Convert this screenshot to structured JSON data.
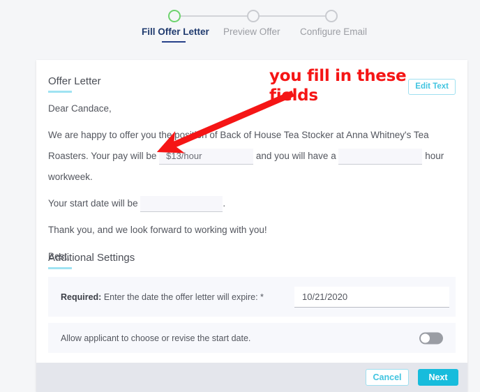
{
  "stepper": {
    "steps": [
      {
        "label": "Fill Offer Letter",
        "state": "active"
      },
      {
        "label": "Preview Offer",
        "state": "upcoming"
      },
      {
        "label": "Configure Email",
        "state": "upcoming"
      }
    ]
  },
  "card": {
    "offer_section": {
      "title": "Offer Letter",
      "edit_button": "Edit Text",
      "greeting": "Dear Candace,",
      "body_part_1": "We are happy to offer you the position of Back of House Tea Stocker at Anna Whitney's Tea Roasters. Your pay will be",
      "pay_value": "$13/hour",
      "body_part_2": "and you will have a",
      "hours_value": "",
      "hours_placeholder": "",
      "body_part_3": "hour workweek.",
      "start_date_prefix": "Your start date will be",
      "start_date_value": "",
      "start_date_suffix": ".",
      "thank_you": "Thank you, and we look forward to working with you!",
      "sign_off": "Best,"
    },
    "additional_settings": {
      "title": "Additional Settings",
      "rows": [
        {
          "label_bold": "Required:",
          "label_rest": " Enter the date the offer letter will expire: *",
          "input_value": "10/21/2020"
        },
        {
          "label": "Allow applicant to choose or revise the start date.",
          "toggle_state": "off"
        }
      ]
    }
  },
  "footer": {
    "cancel_label": "Cancel",
    "next_label": "Next"
  },
  "annotation": {
    "text": "you fill in these fields",
    "color": "#f51515"
  },
  "colors": {
    "accent_cyan": "#17bcdc",
    "rule_cyan": "#9fe3f2",
    "active_step_navy": "#27418a",
    "done_step_green": "#6dd36d",
    "annotation_red": "#f51515"
  }
}
